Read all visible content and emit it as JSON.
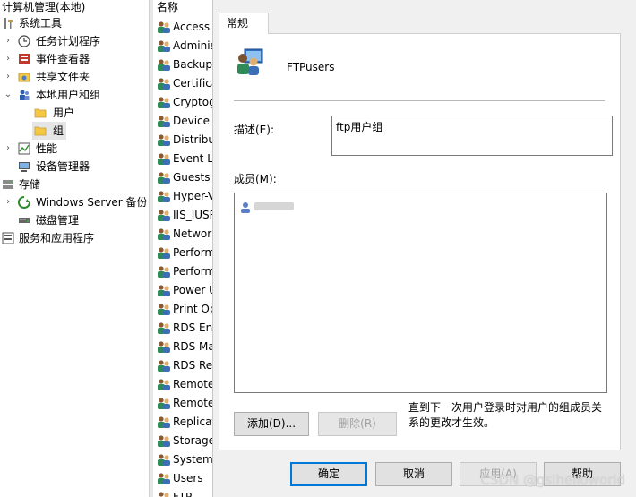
{
  "tree": {
    "header": "计算机管理(本地)",
    "items": [
      {
        "label": "系统工具",
        "arrow": "",
        "icon": "system-tools"
      },
      {
        "label": "任务计划程序",
        "arrow": "›",
        "icon": "clock"
      },
      {
        "label": "事件查看器",
        "arrow": "›",
        "icon": "event-viewer"
      },
      {
        "label": "共享文件夹",
        "arrow": "›",
        "icon": "shared-folder"
      },
      {
        "label": "本地用户和组",
        "arrow": "⌄",
        "icon": "users"
      },
      {
        "label": "用户",
        "arrow": "",
        "icon": "folder"
      },
      {
        "label": "组",
        "arrow": "",
        "icon": "folder"
      },
      {
        "label": "性能",
        "arrow": "›",
        "icon": "performance"
      },
      {
        "label": "设备管理器",
        "arrow": "",
        "icon": "device-manager"
      },
      {
        "label": "存储",
        "arrow": "",
        "icon": "storage"
      },
      {
        "label": "Windows Server 备份",
        "arrow": "›",
        "icon": "backup"
      },
      {
        "label": "磁盘管理",
        "arrow": "",
        "icon": "disk"
      },
      {
        "label": "服务和应用程序",
        "arrow": "",
        "icon": "services"
      }
    ]
  },
  "list": {
    "header": "名称",
    "items": [
      "Access",
      "Adminis",
      "Backup",
      "Certifica",
      "Cryptog",
      "Device",
      "Distribu",
      "Event L",
      "Guests",
      "Hyper-V",
      "IIS_IUSR",
      "Networ",
      "Perform",
      "Perform",
      "Power U",
      "Print Op",
      "RDS En",
      "RDS Ma",
      "RDS Re",
      "Remote",
      "Remote",
      "Replicat",
      "Storage",
      "System",
      "Users",
      "FTP"
    ]
  },
  "dialog": {
    "tab": "常规",
    "group_name": "FTPusers",
    "description_label": "描述(E):",
    "description_value": "ftp用户组",
    "members_label": "成员(M):",
    "member_name": "",
    "add_button": "添加(D)...",
    "remove_button": "删除(R)",
    "note": "直到下一次用户登录时对用户的组成员关系的更改才生效。",
    "ok_button": "确定",
    "cancel_button": "取消",
    "apply_button": "应用(A)",
    "help_button": "帮助"
  },
  "watermark": "CSDN @gslhelloworld",
  "colors": {
    "accent": "#0078d7",
    "folder": "#f4c842",
    "selected_bg": "#cce8ff"
  }
}
